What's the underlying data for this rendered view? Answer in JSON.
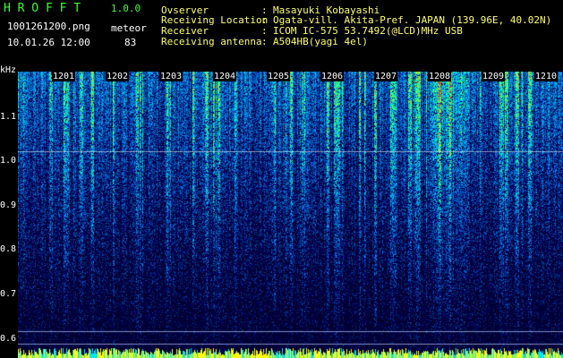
{
  "header": {
    "app_name": "H R O F F T",
    "version": "1.0.0",
    "filename": "1001261200.png",
    "datetime": "10.01.26 12:00",
    "meteor_label": "meteor",
    "meteor_count": "83"
  },
  "info": [
    {
      "label": "Ovserver",
      "value": "Masayuki Kobayashi"
    },
    {
      "label": "Receiving Location",
      "value": "Ogata-vill. Akita-Pref. JAPAN (139.96E, 40.02N)"
    },
    {
      "label": "Receiver",
      "value": "ICOM IC-575 53.7492(@LCD)MHz USB"
    },
    {
      "label": "Receiving antenna",
      "value": "A504HB(yagi 4el)"
    }
  ],
  "separator": ":",
  "axis": {
    "unit": "kHz",
    "ticks": [
      "1.1",
      "1.0",
      "0.9",
      "0.8",
      "0.7",
      "0.6"
    ]
  },
  "time_labels": [
    "1201",
    "1202",
    "1203",
    "1204",
    "1205",
    "1206",
    "1207",
    "1208",
    "1209",
    "1210"
  ],
  "colors": {
    "background": "#000000",
    "header_green": "#39ff2e",
    "header_white": "#ffffff",
    "meteor_yellow": "#ffff66",
    "spectrum_low": "#00003a",
    "spectrum_mid": "#1a66ff",
    "spectrum_high": "#22ffcc",
    "spectrum_peak": "#ff3300",
    "baseline": "#ffff00"
  }
}
